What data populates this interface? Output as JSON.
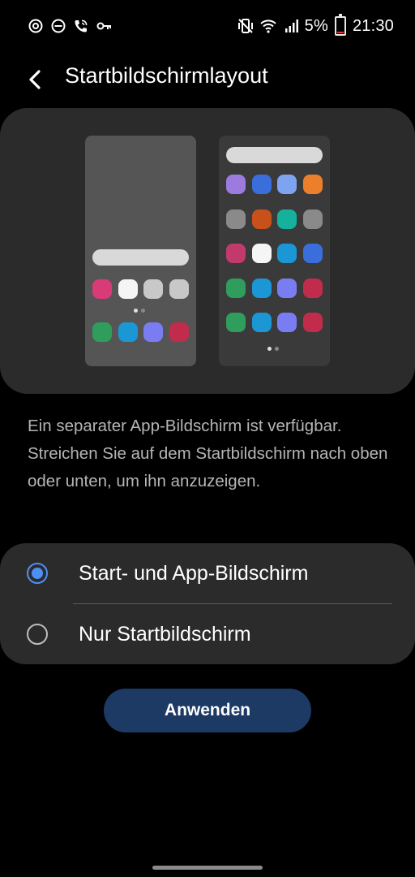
{
  "status_bar": {
    "left_icons": [
      "data-saver-icon",
      "do-not-disturb-icon",
      "wifi-calling-icon",
      "vpn-key-icon"
    ],
    "right_icons": [
      "vibrate-icon",
      "wifi-icon",
      "signal-icon",
      "battery-icon"
    ],
    "battery": "5%",
    "time": "21:30"
  },
  "header": {
    "back_icon": "back-arrow-icon",
    "title": "Startbildschirmlayout"
  },
  "preview": {
    "left_phone_app_colors": {
      "row1": [
        "#d93a78",
        "#f5f5f5",
        "#c8c8c8",
        "#c8c8c8"
      ],
      "row2": [
        "#2f9d5b",
        "#1b97d6",
        "#7a7df1",
        "#c12c4c"
      ]
    },
    "right_phone_app_colors": [
      [
        "#9b7be0",
        "#3a6edc",
        "#7ea3f0",
        "#ec7f2c"
      ],
      [
        "#8a8a8a",
        "#c8501a",
        "#16b19c",
        "#8a8a8a"
      ],
      [
        "#c23a6c",
        "#f5f5f5",
        "#1b97d6",
        "#3a6edc"
      ],
      [
        "#2f9d5b",
        "#1b97d6",
        "#7a7df1",
        "#c12c4c"
      ],
      [
        "#2f9d5b",
        "#1b97d6",
        "#7a7df1",
        "#c12c4c"
      ]
    ]
  },
  "description": "Ein separater App-Bildschirm ist verfügbar. Streichen Sie auf dem Startbildschirm nach oben oder unten, um ihn anzuzeigen.",
  "options": [
    {
      "label": "Start- und App-Bildschirm",
      "selected": true
    },
    {
      "label": "Nur Startbildschirm",
      "selected": false
    }
  ],
  "apply_button": {
    "label": "Anwenden"
  },
  "colors": {
    "accent": "#4e8ff6",
    "button_bg": "#1c3a63",
    "card_bg": "#2b2b2b"
  }
}
